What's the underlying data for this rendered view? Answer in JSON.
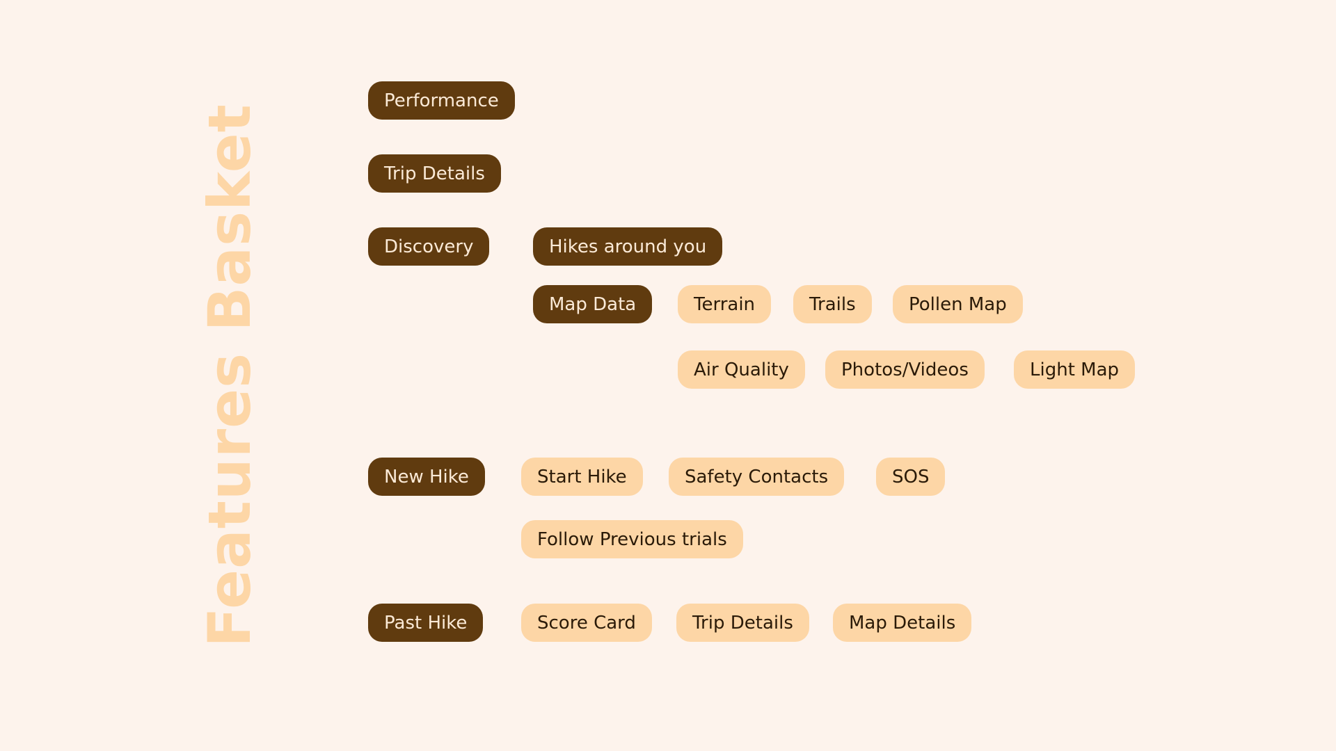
{
  "title": "Features Basket",
  "colors": {
    "background": "#fdf3ec",
    "title": "#fdd6a6",
    "primary_chip": "#603b0f",
    "primary_text": "#fbead7",
    "secondary_chip": "#fdd6a6",
    "secondary_text": "#2a1a08"
  },
  "performance": {
    "label": "Performance"
  },
  "trip_details": {
    "label": "Trip Details"
  },
  "discovery": {
    "label": "Discovery",
    "hikes_around_you": "Hikes around you",
    "map_data": {
      "label": "Map Data",
      "items": [
        "Terrain",
        "Trails",
        "Pollen Map",
        "Air Quality",
        "Photos/Videos",
        "Light Map"
      ]
    }
  },
  "new_hike": {
    "label": "New Hike",
    "items": [
      "Start Hike",
      "Safety Contacts",
      "SOS",
      "Follow Previous trials"
    ]
  },
  "past_hike": {
    "label": "Past Hike",
    "items": [
      "Score Card",
      "Trip Details",
      "Map Details"
    ]
  }
}
